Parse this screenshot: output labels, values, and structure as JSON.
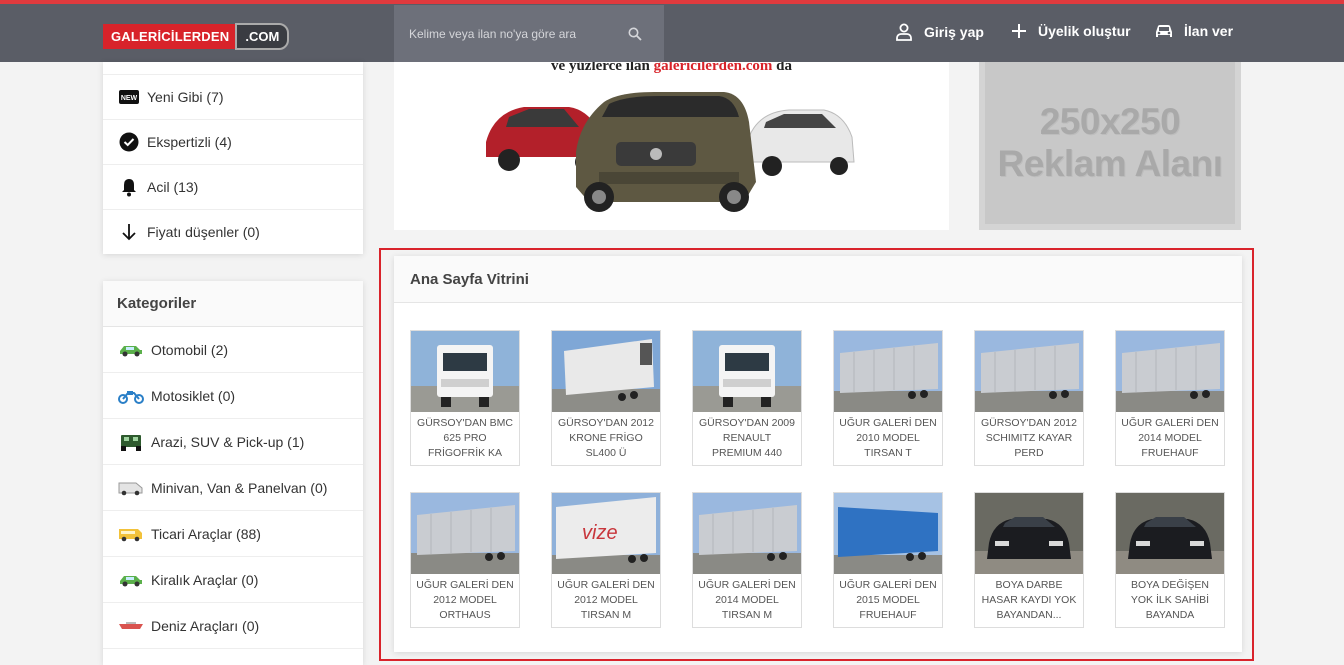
{
  "header": {
    "logo_main": "GALERİCİLERDEN",
    "logo_suffix": ".COM",
    "search_placeholder": "Kelime veya ilan no'ya göre ara",
    "login_label": "Giriş yap",
    "register_label": "Üyelik oluştur",
    "post_ad_label": "İlan ver",
    "accent_color": "#e03a3e"
  },
  "filters": [
    {
      "label": "Yeni Gibi (7)",
      "icon": "new-badge-icon"
    },
    {
      "label": "Ekspertizli (4)",
      "icon": "check-circle-icon"
    },
    {
      "label": "Acil (13)",
      "icon": "bell-icon"
    },
    {
      "label": "Fiyatı düşenler (0)",
      "icon": "arrow-down-icon"
    }
  ],
  "categories": {
    "title": "Kategoriler",
    "items": [
      {
        "label": "Otomobil (2)",
        "icon": "car-icon"
      },
      {
        "label": "Motosiklet (0)",
        "icon": "motorcycle-icon"
      },
      {
        "label": "Arazi, SUV & Pick-up (1)",
        "icon": "jeep-icon"
      },
      {
        "label": "Minivan, Van & Panelvan (0)",
        "icon": "van-icon"
      },
      {
        "label": "Ticari Araçlar (88)",
        "icon": "bus-icon"
      },
      {
        "label": "Kiralık Araçlar (0)",
        "icon": "rental-car-icon"
      },
      {
        "label": "Deniz Araçları (0)",
        "icon": "boat-icon"
      }
    ]
  },
  "banner": {
    "text_pre": "ve yüzlerce ilan ",
    "text_brand": "galericilerden.com",
    "text_post": " da"
  },
  "ad_box": {
    "line1": "250x250",
    "line2": "Reklam Alanı"
  },
  "showcase": {
    "title": "Ana Sayfa Vitrini",
    "highlight_color": "#d9232b",
    "items": [
      {
        "label": "GÜRSOY'DAN BMC 625 PRO FRİGOFRİK KA",
        "thumb": "truck-white-front"
      },
      {
        "label": "GÜRSOY'DAN 2012 KRONE FRİGO SL400 Ü",
        "thumb": "reefer-trailer"
      },
      {
        "label": "GÜRSOY'DAN 2009 RENAULT PREMIUM 440",
        "thumb": "truck-white-front"
      },
      {
        "label": "UĞUR GALERİ DEN 2010 MODEL TIRSAN T",
        "thumb": "curtain-trailer"
      },
      {
        "label": "GÜRSOY'DAN 2012 SCHIMITZ KAYAR PERD",
        "thumb": "curtain-trailer"
      },
      {
        "label": "UĞUR GALERİ DEN 2014 MODEL FRUEHAUF",
        "thumb": "curtain-trailer"
      },
      {
        "label": "UĞUR GALERİ DEN 2012 MODEL ORTHAUS",
        "thumb": "curtain-trailer"
      },
      {
        "label": "UĞUR GALERİ DEN 2012 MODEL TIRSAN M",
        "thumb": "vize-trailer"
      },
      {
        "label": "UĞUR GALERİ DEN 2014 MODEL TIRSAN M",
        "thumb": "curtain-trailer"
      },
      {
        "label": "UĞUR GALERİ DEN 2015 MODEL FRUEHAUF",
        "thumb": "blue-trailer"
      },
      {
        "label": "BOYA DARBE HASAR KAYDI YOK BAYANDAN...",
        "thumb": "black-car"
      },
      {
        "label": "BOYA DEĞİŞEN YOK İLK SAHİBİ BAYANDA",
        "thumb": "black-car"
      }
    ]
  }
}
